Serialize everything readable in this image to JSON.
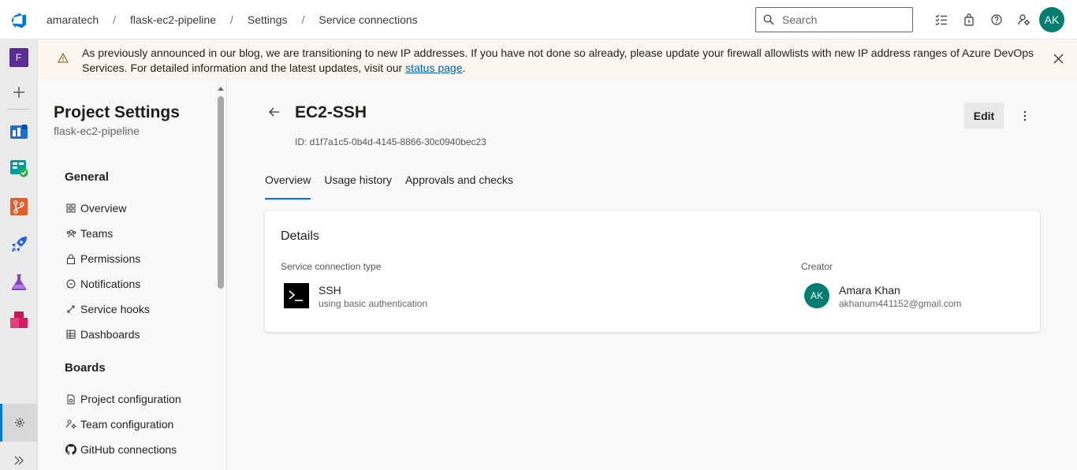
{
  "header": {
    "breadcrumb": [
      "amaratech",
      "flask-ec2-pipeline",
      "Settings",
      "Service connections"
    ],
    "search_placeholder": "Search",
    "user_initials": "AK"
  },
  "rail": {
    "project_initial": "F"
  },
  "banner": {
    "text_before_link": "As previously announced in our blog, we are transitioning to new IP addresses. If you have not done so already, please update your firewall allowlists with new IP address ranges of Azure DevOps Services. For detailed information and the latest updates, visit our ",
    "link_text": "status page",
    "text_after_link": "."
  },
  "sidepanel": {
    "title": "Project Settings",
    "subtitle": "flask-ec2-pipeline",
    "sections": [
      {
        "heading": "General",
        "items": [
          "Overview",
          "Teams",
          "Permissions",
          "Notifications",
          "Service hooks",
          "Dashboards"
        ]
      },
      {
        "heading": "Boards",
        "items": [
          "Project configuration",
          "Team configuration",
          "GitHub connections"
        ]
      }
    ]
  },
  "main": {
    "title": "EC2-SSH",
    "id_line": "ID: d1f7a1c5-0b4d-4145-8866-30c0940bec23",
    "edit_label": "Edit",
    "tabs": [
      "Overview",
      "Usage history",
      "Approvals and checks"
    ],
    "details": {
      "heading": "Details",
      "type_label": "Service connection type",
      "type_name": "SSH",
      "type_sub": "using basic authentication",
      "creator_label": "Creator",
      "creator_initials": "AK",
      "creator_name": "Amara Khan",
      "creator_email": "akhanum441152@gmail.com"
    }
  },
  "colors": {
    "accent": "#0078d4",
    "avatar": "#007d6e",
    "banner_bg": "#fcf4ef"
  }
}
